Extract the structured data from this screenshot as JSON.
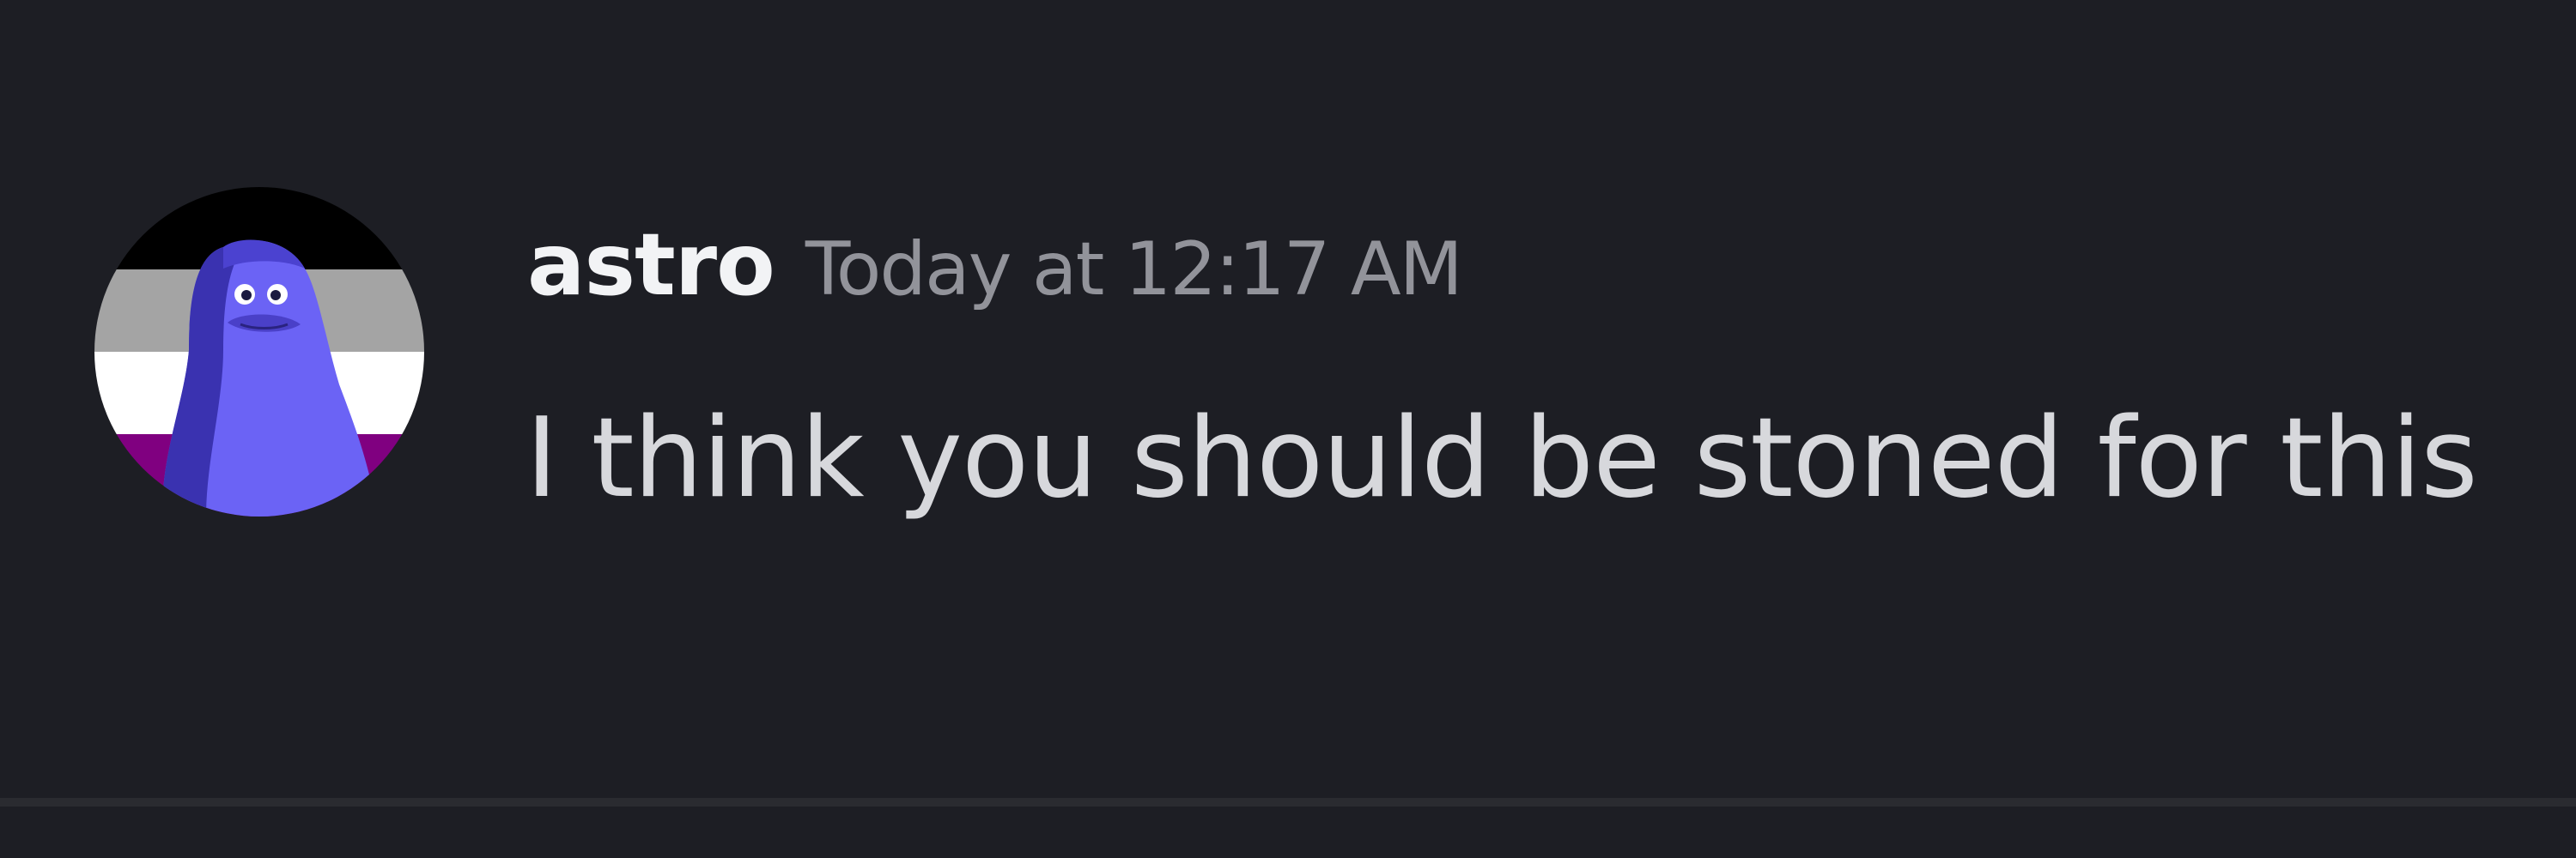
{
  "message": {
    "username": "astro",
    "timestamp": "Today at 12:17 AM",
    "content": "I think you should be stoned for this"
  },
  "avatar": {
    "icon": "penguin-avatar-icon",
    "description_colors": [
      "#000000",
      "#a4a4a4",
      "#ffffff",
      "#800080"
    ],
    "penguin_color": "#6b63f5"
  },
  "colors": {
    "background": "#1d1e24",
    "username": "#f2f3f5",
    "timestamp": "#92939a",
    "content": "#d7d8dc"
  }
}
